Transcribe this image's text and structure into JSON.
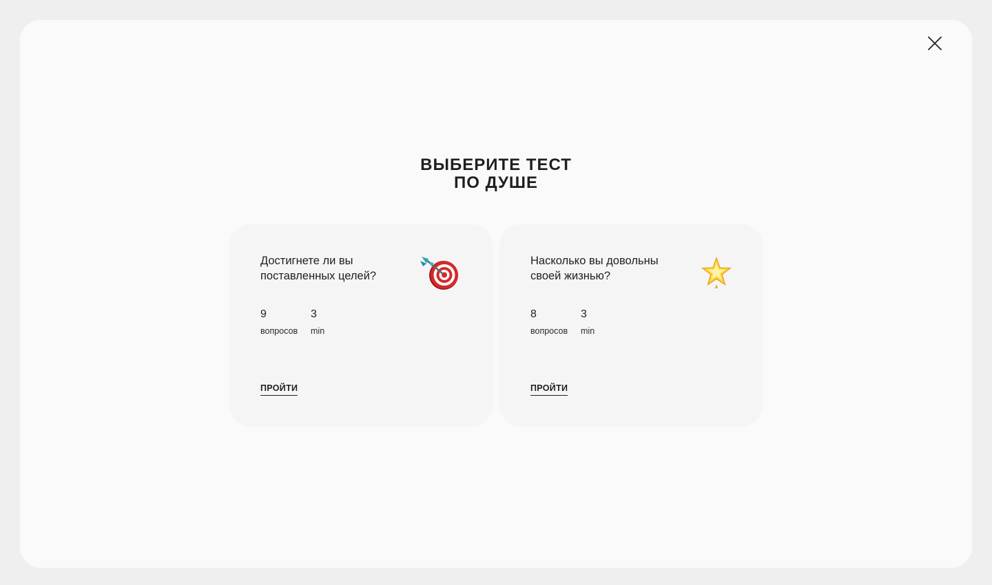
{
  "modal": {
    "title_line1": "ВЫБЕРИТЕ ТЕСТ",
    "title_line2": "ПО ДУШЕ",
    "close_icon": "close-icon"
  },
  "cards": [
    {
      "title": "Достигнете ли вы поставленных целей?",
      "icon": "target-dart-icon",
      "questions_value": "9",
      "questions_label": "вопросов",
      "time_value": "3",
      "time_label": "min",
      "start_label": "ПРОЙТИ"
    },
    {
      "title": "Насколько вы довольны своей жизнью?",
      "icon": "glowing-star-icon",
      "questions_value": "8",
      "questions_label": "вопросов",
      "time_value": "3",
      "time_label": "min",
      "start_label": "ПРОЙТИ"
    }
  ]
}
